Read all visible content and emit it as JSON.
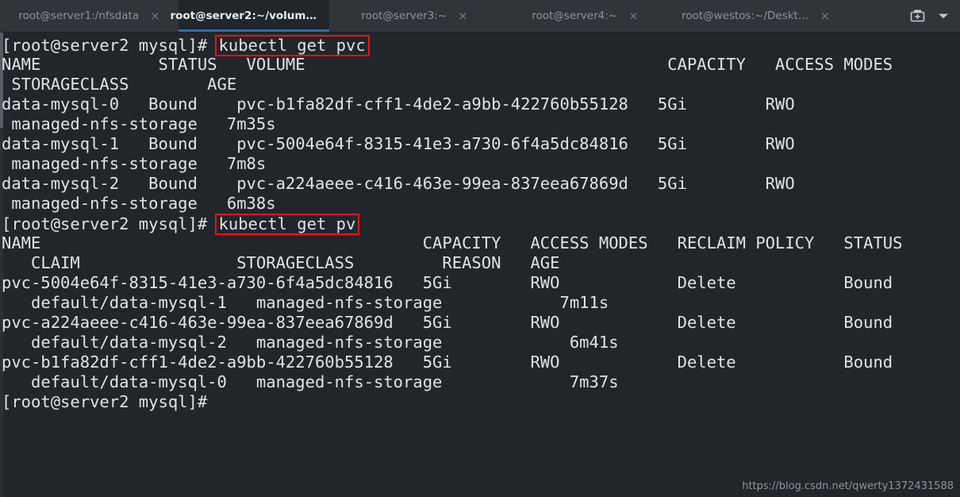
{
  "window": {
    "background_color": "#22262a",
    "tabbar_color": "#30353a",
    "accent_color": "#2f6fb5",
    "highlight_color": "#ee1111",
    "text_color": "#dfe4e7"
  },
  "tabbar": {
    "tabs": [
      {
        "label": "root@server1:/nfsdata",
        "active": false,
        "close_icon": "×"
      },
      {
        "label": "root@server2:~/volum…",
        "active": true,
        "close_icon": "×"
      },
      {
        "label": "root@server3:~",
        "active": false,
        "close_icon": "×"
      },
      {
        "label": "root@server4:~",
        "active": false,
        "close_icon": "×"
      },
      {
        "label": "root@westos:~/Deskt…",
        "active": false,
        "close_icon": "×"
      }
    ],
    "new_tab_icon": "add-tab-icon",
    "menu_icon": "chevron-down-icon"
  },
  "terminal": {
    "prompt": "[root@server2 mysql]#",
    "commands": {
      "get_pvc": "kubectl get pvc",
      "get_pv": "kubectl get pv"
    },
    "pvc_table": {
      "header_line1": "NAME            STATUS   VOLUME                                     CAPACITY   ACCESS MODES",
      "header_line2": " STORAGECLASS        AGE",
      "rows": [
        {
          "line1": "data-mysql-0   Bound    pvc-b1fa82df-cff1-4de2-a9bb-422760b55128   5Gi        RWO",
          "line2": " managed-nfs-storage   7m35s",
          "name": "data-mysql-0",
          "status": "Bound",
          "volume": "pvc-b1fa82df-cff1-4de2-a9bb-422760b55128",
          "capacity": "5Gi",
          "access_modes": "RWO",
          "storageclass": "managed-nfs-storage",
          "age": "7m35s"
        },
        {
          "line1": "data-mysql-1   Bound    pvc-5004e64f-8315-41e3-a730-6f4a5dc84816   5Gi        RWO",
          "line2": " managed-nfs-storage   7m8s",
          "name": "data-mysql-1",
          "status": "Bound",
          "volume": "pvc-5004e64f-8315-41e3-a730-6f4a5dc84816",
          "capacity": "5Gi",
          "access_modes": "RWO",
          "storageclass": "managed-nfs-storage",
          "age": "7m8s"
        },
        {
          "line1": "data-mysql-2   Bound    pvc-a224aeee-c416-463e-99ea-837eea67869d   5Gi        RWO",
          "line2": " managed-nfs-storage   6m38s",
          "name": "data-mysql-2",
          "status": "Bound",
          "volume": "pvc-a224aeee-c416-463e-99ea-837eea67869d",
          "capacity": "5Gi",
          "access_modes": "RWO",
          "storageclass": "managed-nfs-storage",
          "age": "6m38s"
        }
      ]
    },
    "pv_table": {
      "header_line1": "NAME                                       CAPACITY   ACCESS MODES   RECLAIM POLICY   STATUS",
      "header_line2": "   CLAIM                STORAGECLASS         REASON   AGE",
      "rows": [
        {
          "line1": "pvc-5004e64f-8315-41e3-a730-6f4a5dc84816   5Gi        RWO            Delete           Bound",
          "line2": "   default/data-mysql-1   managed-nfs-storage            7m11s",
          "name": "pvc-5004e64f-8315-41e3-a730-6f4a5dc84816",
          "capacity": "5Gi",
          "access_modes": "RWO",
          "reclaim_policy": "Delete",
          "status": "Bound",
          "claim": "default/data-mysql-1",
          "storageclass": "managed-nfs-storage",
          "reason": "",
          "age": "7m11s"
        },
        {
          "line1": "pvc-a224aeee-c416-463e-99ea-837eea67869d   5Gi        RWO            Delete           Bound",
          "line2": "   default/data-mysql-2   managed-nfs-storage             6m41s",
          "name": "pvc-a224aeee-c416-463e-99ea-837eea67869d",
          "capacity": "5Gi",
          "access_modes": "RWO",
          "reclaim_policy": "Delete",
          "status": "Bound",
          "claim": "default/data-mysql-2",
          "storageclass": "managed-nfs-storage",
          "reason": "",
          "age": "6m41s"
        },
        {
          "line1": "pvc-b1fa82df-cff1-4de2-a9bb-422760b55128   5Gi        RWO            Delete           Bound",
          "line2": "   default/data-mysql-0   managed-nfs-storage             7m37s",
          "name": "pvc-b1fa82df-cff1-4de2-a9bb-422760b55128",
          "capacity": "5Gi",
          "access_modes": "RWO",
          "reclaim_policy": "Delete",
          "status": "Bound",
          "claim": "default/data-mysql-0",
          "storageclass": "managed-nfs-storage",
          "reason": "",
          "age": "7m37s"
        }
      ]
    }
  },
  "watermark": {
    "text": "https://blog.csdn.net/qwerty1372431588"
  }
}
